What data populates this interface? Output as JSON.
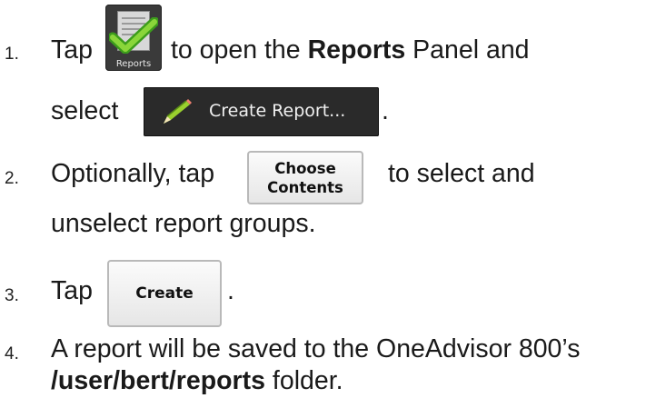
{
  "steps": {
    "s1": {
      "number": "1.",
      "tap": "Tap",
      "after_icon": "to open the",
      "reports_bold": "Reports",
      "panel": "Panel and",
      "select": "select",
      "period": ".",
      "reports_icon_caption": "Reports",
      "create_report_button": "Create Report..."
    },
    "s2": {
      "number": "2.",
      "text_before": "Optionally, tap",
      "choose_line1": "Choose",
      "choose_line2": "Contents",
      "text_after": "to select and",
      "text_line2": "unselect report groups."
    },
    "s3": {
      "number": "3.",
      "tap": "Tap",
      "create_button": "Create",
      "period": "."
    },
    "s4": {
      "number": "4.",
      "line1": "A report will be saved to the OneAdvisor 800’s",
      "folder": "/user/bert/reports",
      "folder_suffix": "folder."
    }
  },
  "icons": {
    "reports_icon": "reports-checkmark-icon",
    "create_report_icon": "pencil-icon"
  }
}
